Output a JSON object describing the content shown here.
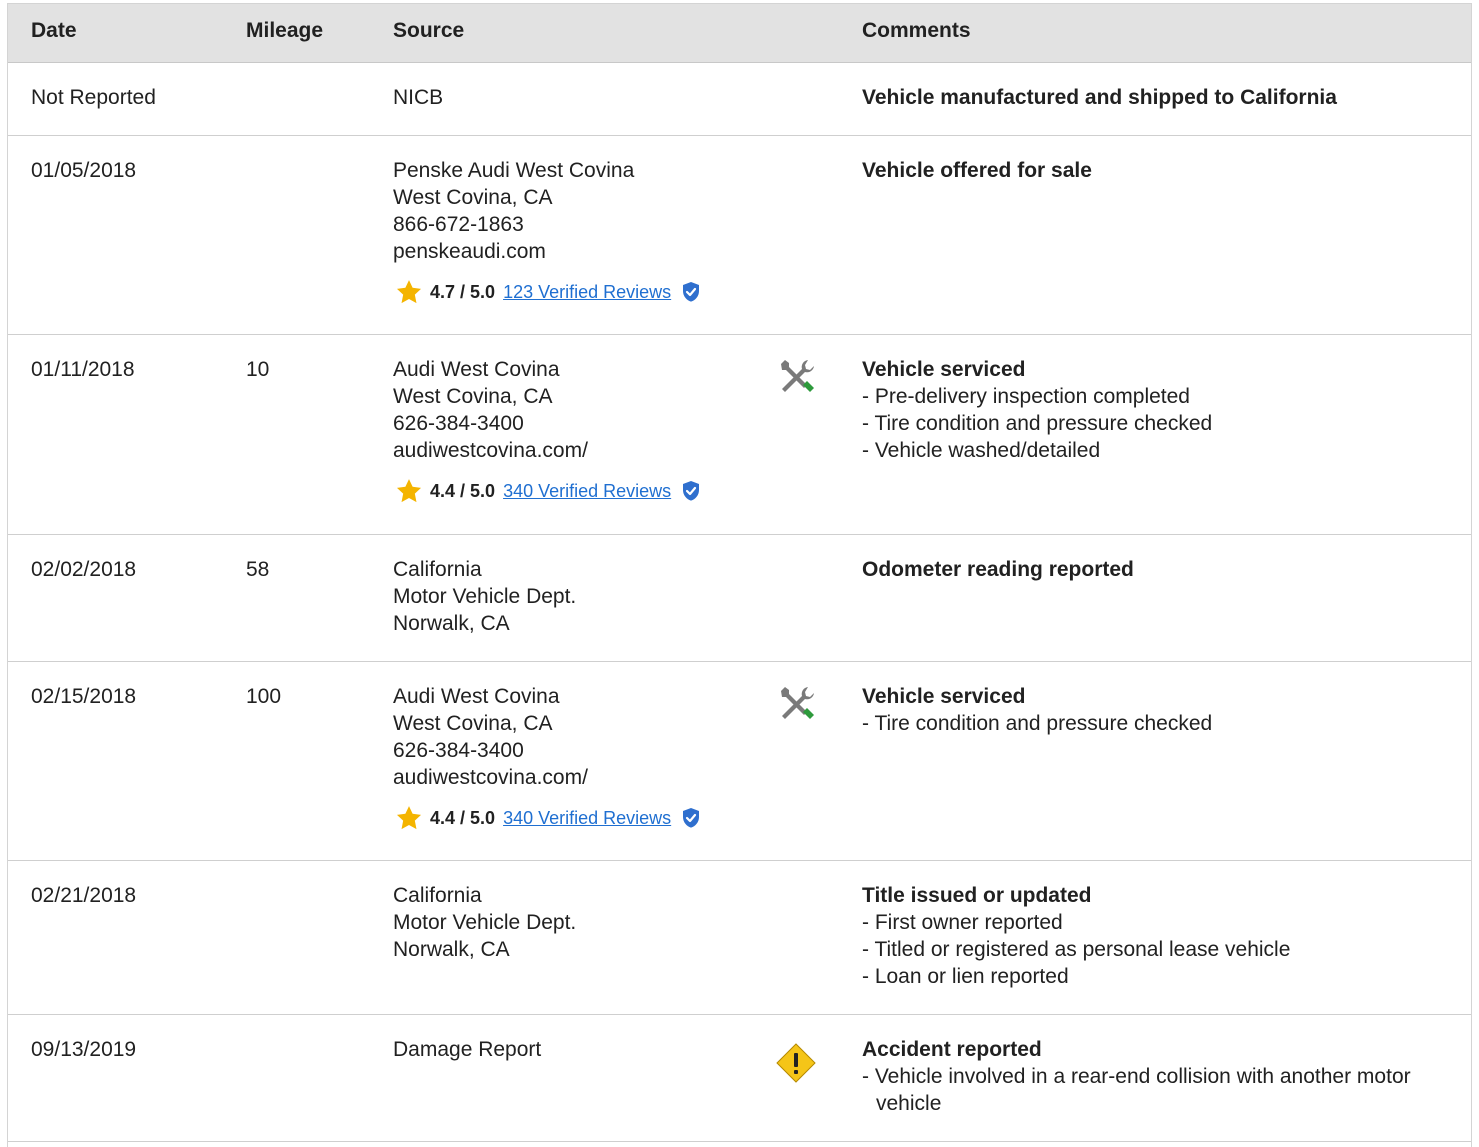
{
  "header": {
    "date": "Date",
    "mileage": "Mileage",
    "source": "Source",
    "comments": "Comments"
  },
  "rows": [
    {
      "date": "Not Reported",
      "mileage": "",
      "source": [
        "NICB"
      ],
      "icon": "",
      "comment_title": "Vehicle manufactured and shipped to California",
      "comment_items": []
    },
    {
      "date": "01/05/2018",
      "mileage": "",
      "source": [
        "Penske Audi West Covina",
        "West Covina, CA",
        "866-672-1863",
        "penskeaudi.com"
      ],
      "rating": {
        "score": "4.7 / 5.0",
        "reviews": "123 Verified Reviews"
      },
      "icon": "",
      "comment_title": "Vehicle offered for sale",
      "comment_items": []
    },
    {
      "date": "01/11/2018",
      "mileage": "10",
      "source": [
        "Audi West Covina",
        "West Covina, CA",
        "626-384-3400",
        "audiwestcovina.com/"
      ],
      "rating": {
        "score": "4.4 / 5.0",
        "reviews": "340 Verified Reviews"
      },
      "icon": "service-tools-icon",
      "comment_title": "Vehicle serviced",
      "comment_items": [
        "- Pre-delivery inspection completed",
        "- Tire condition and pressure checked",
        "- Vehicle washed/detailed"
      ]
    },
    {
      "date": "02/02/2018",
      "mileage": "58",
      "source": [
        "California",
        "Motor Vehicle Dept.",
        "Norwalk, CA"
      ],
      "icon": "",
      "comment_title": "Odometer reading reported",
      "comment_items": []
    },
    {
      "date": "02/15/2018",
      "mileage": "100",
      "source": [
        "Audi West Covina",
        "West Covina, CA",
        "626-384-3400",
        "audiwestcovina.com/"
      ],
      "rating": {
        "score": "4.4 / 5.0",
        "reviews": "340 Verified Reviews"
      },
      "icon": "service-tools-icon",
      "comment_title": "Vehicle serviced",
      "comment_items": [
        "- Tire condition and pressure checked"
      ]
    },
    {
      "date": "02/21/2018",
      "mileage": "",
      "source": [
        "California",
        "Motor Vehicle Dept.",
        "Norwalk, CA"
      ],
      "icon": "",
      "comment_title": "Title issued or updated",
      "comment_items": [
        "- First owner reported",
        "- Titled or registered as personal lease vehicle",
        "- Loan or lien reported"
      ]
    },
    {
      "date": "09/13/2019",
      "mileage": "",
      "source": [
        "Damage Report"
      ],
      "icon": "accident-warning-icon",
      "comment_title": "Accident reported",
      "comment_items": [
        "- Vehicle involved in a rear-end collision with another motor vehicle"
      ]
    }
  ],
  "colors": {
    "header_bg": "#e2e2e2",
    "link": "#1f6fd1",
    "star": "#f4b400",
    "verified_shield": "#2f6fce",
    "tool_gray": "#7a7a7a",
    "tool_green": "#2e9a3c",
    "warning_yellow": "#f5c518"
  }
}
